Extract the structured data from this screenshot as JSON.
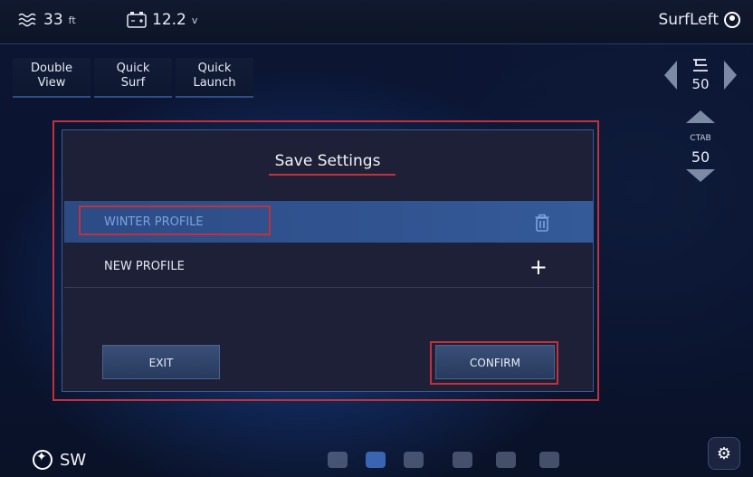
{
  "status": {
    "depth_value": "33",
    "depth_unit": "ft",
    "battery_value": "12.2",
    "battery_unit": "v",
    "profile_name": "SurfLeft"
  },
  "modes": [
    {
      "label": "Double\nView"
    },
    {
      "label": "Quick\nSurf"
    },
    {
      "label": "Quick\nLaunch"
    }
  ],
  "right_panel": {
    "wave_value": "50",
    "ctab_label": "CTAB",
    "ctab_value": "50"
  },
  "dialog": {
    "title": "Save Settings",
    "profiles": [
      {
        "label": "WINTER PROFILE",
        "action_icon": "trash-icon"
      },
      {
        "label": "NEW PROFILE",
        "action_icon": "plus-icon"
      }
    ],
    "exit_label": "EXIT",
    "confirm_label": "CONFIRM"
  },
  "bottom": {
    "heading": "SW"
  },
  "colors": {
    "highlight": "#c2303d",
    "selected_row": "#345a98",
    "selected_text": "#7aa3e0"
  }
}
